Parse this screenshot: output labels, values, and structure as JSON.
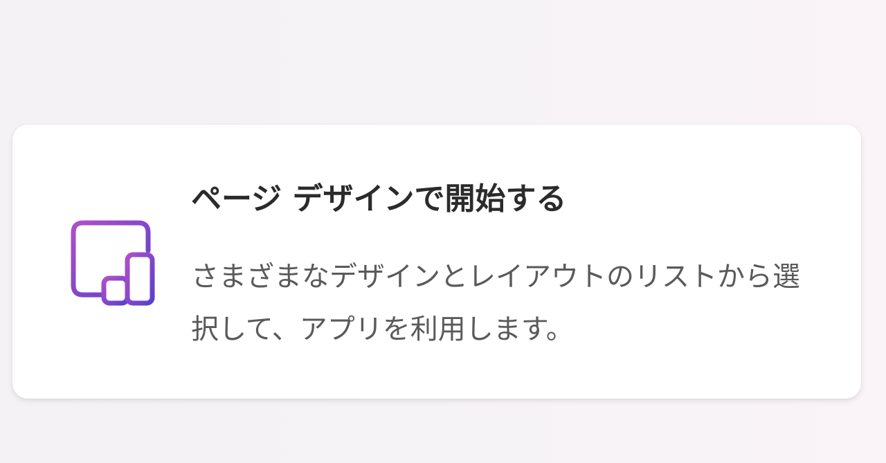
{
  "card": {
    "title": "ページ デザインで開始する",
    "description": "さまざまなデザインとレイアウトのリストから選択して、アプリを利用します。",
    "icon": "page-layout-icon",
    "icon_gradient": [
      "#b04fc7",
      "#5a3fd0"
    ]
  },
  "colors": {
    "background": "#f5f3f6",
    "card_background": "#ffffff",
    "title_text": "#2b2b2b",
    "description_text": "#5a5a5a"
  }
}
